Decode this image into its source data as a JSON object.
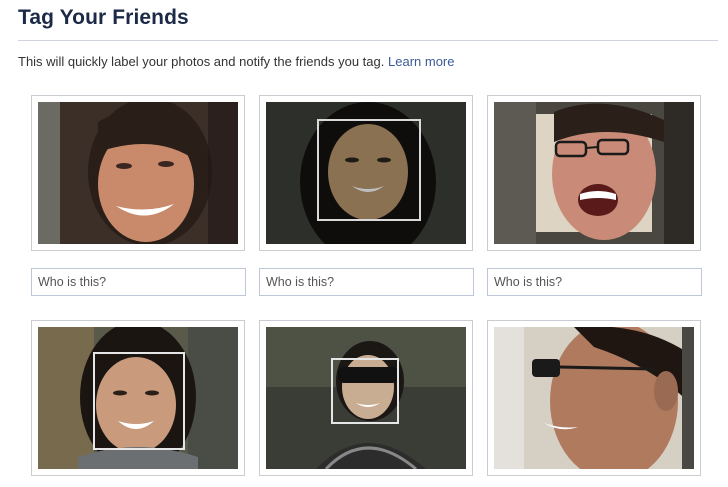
{
  "header": {
    "title": "Tag Your Friends"
  },
  "intro": {
    "text": "This will quickly label your photos and notify the friends you tag.",
    "learn_more": "Learn more"
  },
  "photos": [
    {
      "tag_placeholder": "Who is this?"
    },
    {
      "tag_placeholder": "Who is this?"
    },
    {
      "tag_placeholder": "Who is this?"
    },
    {
      "tag_placeholder": ""
    },
    {
      "tag_placeholder": ""
    },
    {
      "tag_placeholder": ""
    }
  ],
  "colors": {
    "title": "#1c2a47",
    "link": "#3b5998",
    "border": "#c9ccd1",
    "input_border": "#bdc7d8"
  }
}
